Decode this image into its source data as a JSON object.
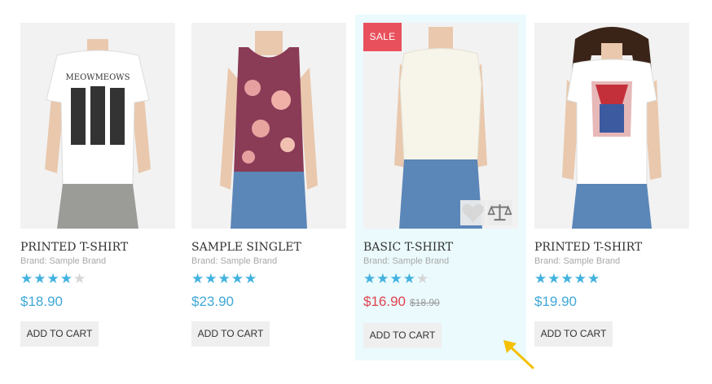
{
  "products": [
    {
      "title": "PRINTED T-SHIRT",
      "brand": "Brand: Sample Brand",
      "rating": 4,
      "rating_max": 5,
      "price": "$18.90",
      "add_to_cart": "ADD TO CART"
    },
    {
      "title": "SAMPLE SINGLET",
      "brand": "Brand: Sample Brand",
      "rating": 5,
      "rating_max": 5,
      "price": "$23.90",
      "add_to_cart": "ADD TO CART"
    },
    {
      "title": "BASIC T-SHIRT",
      "brand": "Brand: Sample Brand",
      "rating": 4,
      "rating_max": 5,
      "price": "$16.90",
      "old_price": "$18.90",
      "badge": "SALE",
      "add_to_cart": "ADD TO CART",
      "highlighted": true
    },
    {
      "title": "PRINTED T-SHIRT",
      "brand": "Brand: Sample Brand",
      "rating": 5,
      "rating_max": 5,
      "price": "$19.90",
      "add_to_cart": "ADD TO CART"
    }
  ],
  "colors": {
    "price": "#3fa8d8",
    "sale_price": "#e0434e",
    "sale_badge": "#e8505b",
    "star": "#43b2e0",
    "highlight_bg": "#eafafd",
    "arrow": "#f5c000"
  },
  "icons": {
    "wishlist": "heart-icon",
    "compare": "scale-icon",
    "pointer": "arrow-icon"
  }
}
